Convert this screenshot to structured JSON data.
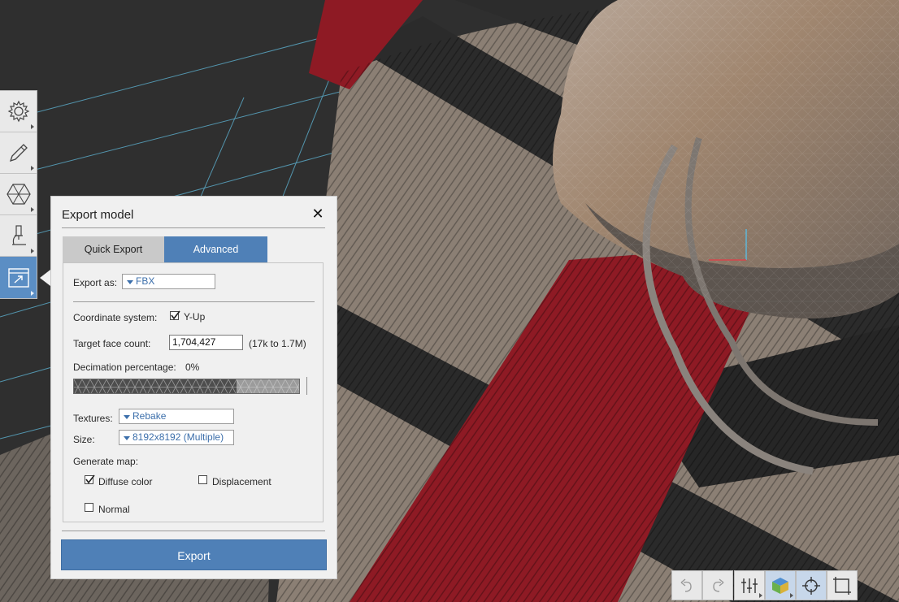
{
  "toolbar": {
    "tools": [
      {
        "icon": "gear-icon"
      },
      {
        "icon": "pencil-icon"
      },
      {
        "icon": "mesh-icon"
      },
      {
        "icon": "microscope-icon"
      },
      {
        "icon": "export-icon",
        "active": true
      }
    ]
  },
  "dialog": {
    "title": "Export model",
    "close_glyph": "✕",
    "tabs": {
      "quick": "Quick Export",
      "advanced": "Advanced"
    },
    "export_as": {
      "label": "Export as:",
      "value": "FBX"
    },
    "coordinate_system": {
      "label": "Coordinate system:",
      "option": "Y-Up",
      "checked": true
    },
    "target_face_count": {
      "label": "Target face count:",
      "value": "1,704,427",
      "range": "(17k to 1.7M)"
    },
    "decimation": {
      "label": "Decimation percentage:",
      "value": "0%",
      "percent": 0
    },
    "textures": {
      "label": "Textures:",
      "value": "Rebake"
    },
    "size": {
      "label": "Size:",
      "value": "8192x8192 (Multiple)"
    },
    "generate_map": {
      "label": "Generate map:",
      "diffuse": {
        "label": "Diffuse color",
        "checked": true
      },
      "displacement": {
        "label": "Displacement",
        "checked": false
      },
      "normal": {
        "label": "Normal",
        "checked": false
      }
    },
    "export_button": "Export"
  },
  "view_tools": [
    {
      "icon": "undo-icon"
    },
    {
      "icon": "redo-icon"
    },
    {
      "icon": "adjust-sliders-icon"
    },
    {
      "icon": "shaded-cube-icon",
      "active": true
    },
    {
      "icon": "crosshair-icon",
      "active": true
    },
    {
      "icon": "frame-icon"
    }
  ],
  "colors": {
    "accent": "#4f80b7",
    "panel": "#f0f0f0",
    "viewport_bg": "#2f2f2f",
    "grid": "#5fb7d8",
    "fabric_red": "#8e1a24"
  }
}
